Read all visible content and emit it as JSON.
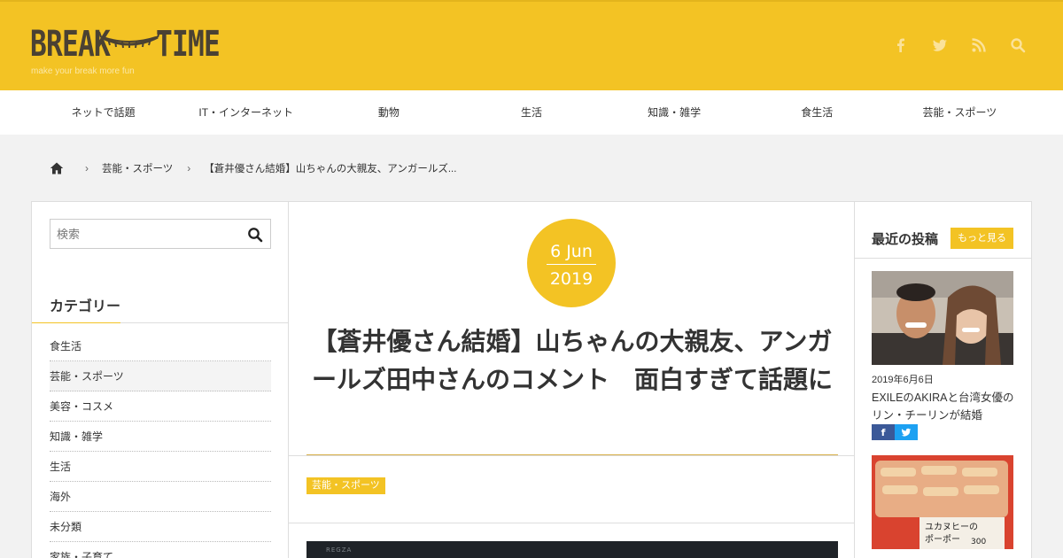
{
  "header": {
    "logo_left": "BREAK",
    "logo_right": "TIME",
    "tagline": "make your break more fun",
    "icons": [
      "facebook-icon",
      "twitter-icon",
      "rss-icon",
      "search-icon"
    ]
  },
  "nav": {
    "items": [
      {
        "label": "ネットで話題"
      },
      {
        "label": "IT・インターネット"
      },
      {
        "label": "動物"
      },
      {
        "label": "生活"
      },
      {
        "label": "知識・雑学"
      },
      {
        "label": "食生活"
      },
      {
        "label": "芸能・スポーツ"
      }
    ]
  },
  "breadcrumb": {
    "category": "芸能・スポーツ",
    "current": "【蒼井優さん結婚】山ちゃんの大親友、アンガールズ..."
  },
  "sidebar": {
    "search_placeholder": "検索",
    "category_title": "カテゴリー",
    "categories": [
      {
        "label": "食生活"
      },
      {
        "label": "芸能・スポーツ"
      },
      {
        "label": "美容・コスメ"
      },
      {
        "label": "知識・雑学"
      },
      {
        "label": "生活"
      },
      {
        "label": "海外"
      },
      {
        "label": "未分類"
      },
      {
        "label": "家族・子育て"
      }
    ]
  },
  "article": {
    "date_day": "6 Jun",
    "date_year": "2019",
    "title": "【蒼井優さん結婚】山ちゃんの大親友、アンガールズ田中さんのコメント　面白すぎて話題に",
    "tag": "芸能・スポーツ",
    "hero_brand": "REGZA"
  },
  "recent": {
    "title": "最近の投稿",
    "more_label": "もっと見る",
    "posts": [
      {
        "date": "2019年6月6日",
        "text": "EXILEのAKIRAと台湾女優のリン・チーリンが結婚"
      },
      {
        "date": "",
        "text": ""
      }
    ],
    "thumb2_caption1": "ユカヌヒーの",
    "thumb2_caption2": "ポーポー",
    "thumb2_price": "300"
  },
  "colors": {
    "accent": "#f3c324",
    "facebook": "#3b5998",
    "twitter": "#1da1f2"
  }
}
